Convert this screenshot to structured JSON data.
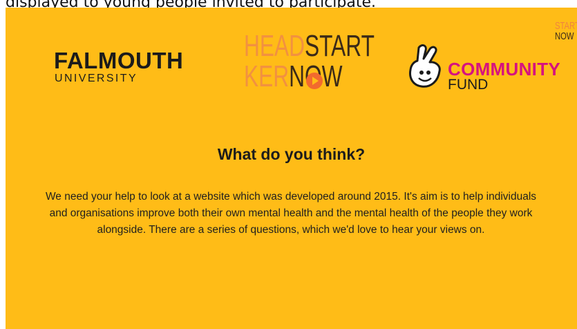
{
  "caption": "displayed to young people invited to participate.",
  "logos": {
    "falmouth": {
      "name": "FALMOUTH",
      "sub": "UNIVERSITY"
    },
    "headstart": {
      "line1_light": "HEAD",
      "line1_dark": "START",
      "line2_light": "KER",
      "line2_dark": "NOW"
    },
    "community_fund": {
      "line1": "COMMUNITY",
      "line2": "FUND",
      "icon": "crossed-fingers-hand-icon"
    },
    "corner": {
      "line1": "START",
      "line2": "NOW"
    }
  },
  "slide": {
    "heading": "What do you think?",
    "body": "We need your help to look at a website which was developed around 2015.  It's aim is to help individuals and organisations improve both their own mental health and the mental health of the people they work alongside. There are a series of questions, which we'd love to hear your views on."
  },
  "colors": {
    "background": "#ffbc17",
    "accent_pink": "#d6127f",
    "accent_orange": "#f26a2e"
  }
}
